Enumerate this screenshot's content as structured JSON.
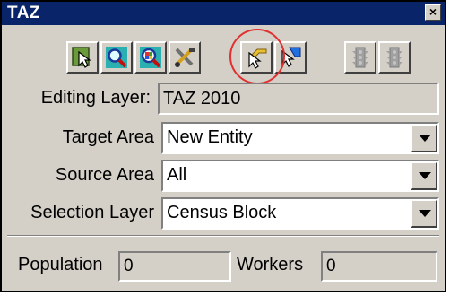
{
  "window": {
    "title": "TAZ",
    "close_glyph": "×"
  },
  "toolbar": {
    "items": [
      {
        "name": "select-pointer-icon",
        "enabled": true
      },
      {
        "name": "zoom-blue-icon",
        "enabled": true
      },
      {
        "name": "zoom-multicolor-icon",
        "enabled": true
      },
      {
        "name": "tools-settings-icon",
        "enabled": true
      },
      {
        "name": "pointer-add-icon",
        "enabled": true,
        "highlighted": true
      },
      {
        "name": "pointer-blue-icon",
        "enabled": true
      },
      {
        "name": "traffic-light-icon",
        "enabled": false
      },
      {
        "name": "traffic-light-icon",
        "enabled": false
      }
    ]
  },
  "editing_layer": {
    "label": "Editing Layer:",
    "value": "TAZ 2010"
  },
  "target_area": {
    "label": "Target Area",
    "value": "New Entity"
  },
  "source_area": {
    "label": "Source Area",
    "value": "All"
  },
  "selection_layer": {
    "label": "Selection Layer",
    "value": "Census Block"
  },
  "population": {
    "label": "Population",
    "value": "0"
  },
  "workers": {
    "label": "Workers",
    "value": "0"
  },
  "colors": {
    "title_bar": "#0a246a",
    "dialog_bg": "#d4d0c8",
    "highlight_circle": "#e03030"
  }
}
